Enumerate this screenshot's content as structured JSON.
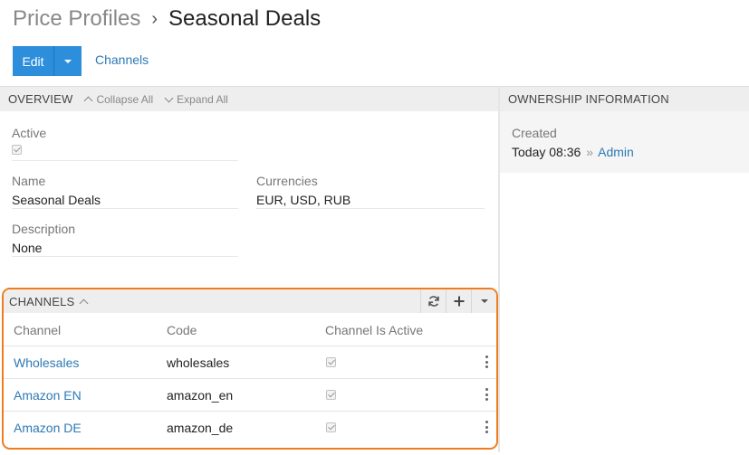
{
  "breadcrumb": {
    "parent": "Price Profiles",
    "separator": "›",
    "current": "Seasonal Deals"
  },
  "toolbar": {
    "edit_label": "Edit",
    "channels_link": "Channels"
  },
  "overview": {
    "title": "OVERVIEW",
    "collapse_all": "Collapse All",
    "expand_all": "Expand All",
    "active_label": "Active",
    "active_checked": true,
    "name_label": "Name",
    "name_value": "Seasonal Deals",
    "currencies_label": "Currencies",
    "currencies_value": "EUR, USD, RUB",
    "description_label": "Description",
    "description_value": "None"
  },
  "ownership": {
    "title": "OWNERSHIP INFORMATION",
    "created_label": "Created",
    "created_time": "Today 08:36",
    "created_sep": "»",
    "created_user": "Admin"
  },
  "channels": {
    "title": "CHANNELS",
    "columns": [
      "Channel",
      "Code",
      "Channel Is Active"
    ],
    "rows": [
      {
        "channel": "Wholesales",
        "code": "wholesales",
        "active": true
      },
      {
        "channel": "Amazon EN",
        "code": "amazon_en",
        "active": true
      },
      {
        "channel": "Amazon DE",
        "code": "amazon_de",
        "active": true
      }
    ],
    "tools": [
      "refresh-icon",
      "plus-icon",
      "caret-down-icon"
    ]
  },
  "colors": {
    "accent": "#2d8fdc",
    "link": "#2d79b5",
    "highlight": "#ef7d1e"
  }
}
